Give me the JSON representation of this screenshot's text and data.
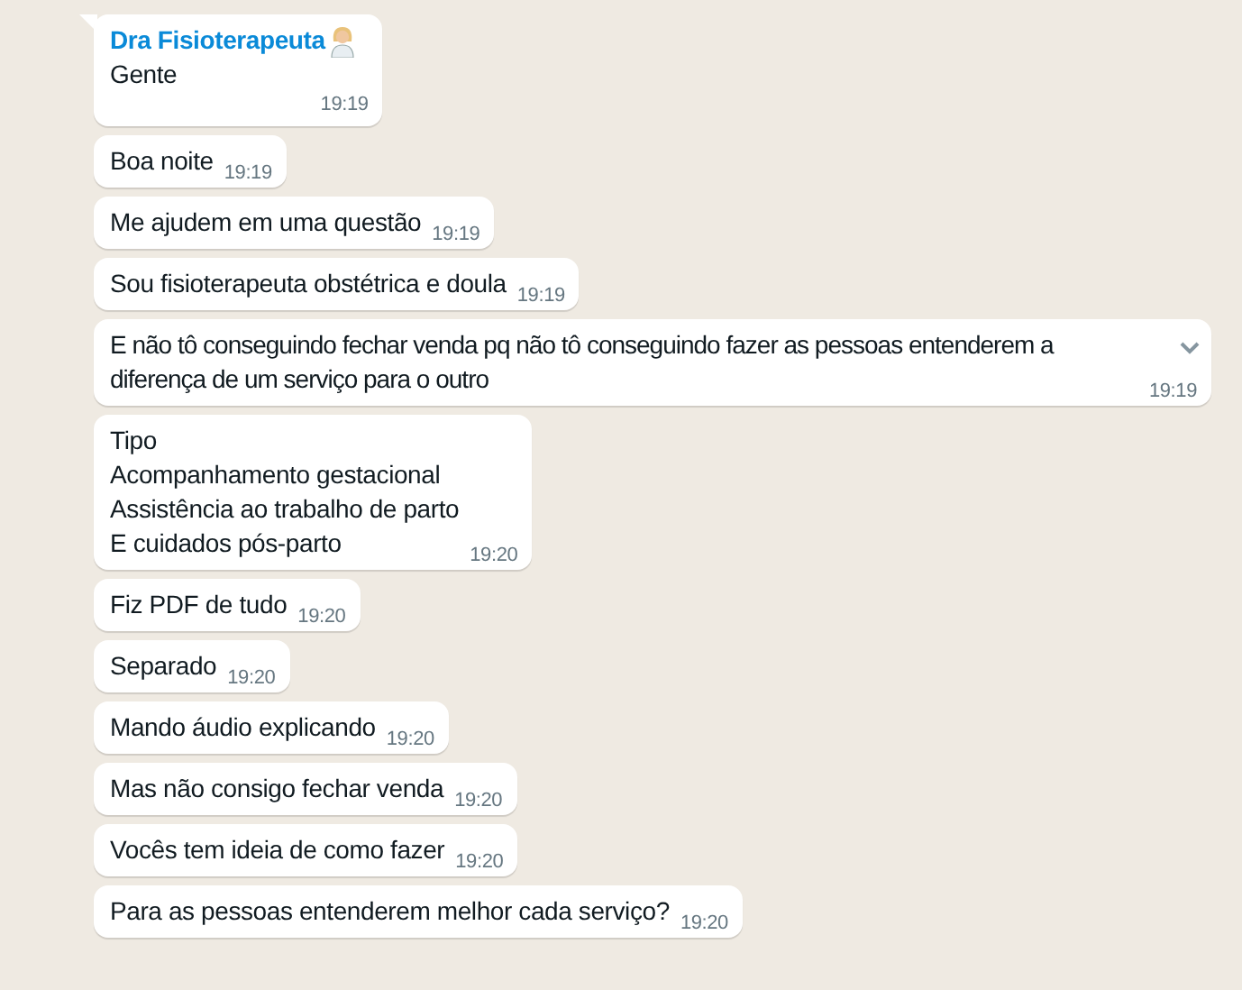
{
  "messages": [
    {
      "sender": "Dra Fisioterapeuta",
      "text": "Gente",
      "time": "19:19",
      "show_menu": false
    },
    {
      "text": "Boa noite",
      "time": "19:19",
      "show_menu": false
    },
    {
      "text": "Me ajudem em uma questão",
      "time": "19:19",
      "show_menu": false
    },
    {
      "text": "Sou fisioterapeuta obstétrica e doula",
      "time": "19:19",
      "show_menu": false
    },
    {
      "text": "E não tô conseguindo fechar venda pq não tô conseguindo fazer as pessoas entenderem a diferença de um serviço para o outro",
      "time": "19:19",
      "show_menu": true
    },
    {
      "text": "Tipo\nAcompanhamento gestacional\nAssistência ao trabalho de parto\nE cuidados pós-parto",
      "time": "19:20",
      "show_menu": false
    },
    {
      "text": "Fiz PDF de tudo",
      "time": "19:20",
      "show_menu": false
    },
    {
      "text": "Separado",
      "time": "19:20",
      "show_menu": false
    },
    {
      "text": "Mando áudio explicando",
      "time": "19:20",
      "show_menu": false
    },
    {
      "text": "Mas não consigo fechar venda",
      "time": "19:20",
      "show_menu": false
    },
    {
      "text": "Vocês tem ideia de como fazer",
      "time": "19:20",
      "show_menu": false
    },
    {
      "text": "Para as pessoas entenderem melhor cada serviço?",
      "time": "19:20",
      "show_menu": false
    }
  ]
}
